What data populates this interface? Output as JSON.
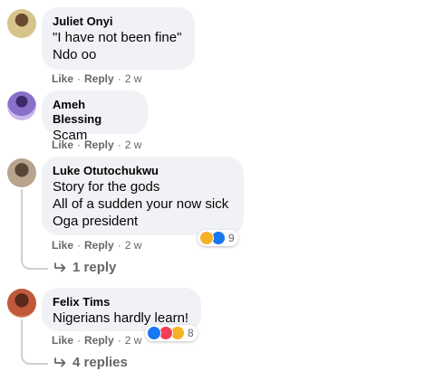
{
  "comments": [
    {
      "name": "Juliet Onyi",
      "lines": [
        "\"I have not been fine\"",
        "Ndo oo"
      ],
      "actions": {
        "like": "Like",
        "reply": "Reply",
        "time": "2 w"
      }
    },
    {
      "name": "Ameh Blessing",
      "lines": [
        "Scam"
      ],
      "actions": {
        "like": "Like",
        "reply": "Reply",
        "time": "2 w"
      }
    },
    {
      "name": "Luke Otutochukwu",
      "lines": [
        "Story for the gods",
        "All of a sudden your now sick",
        "Oga president"
      ],
      "actions": {
        "like": "Like",
        "reply": "Reply",
        "time": "2 w"
      },
      "reactions": {
        "icons": [
          "haha-icon",
          "like-icon"
        ],
        "count": "9"
      },
      "replies": "1 reply"
    },
    {
      "name": "Felix Tims",
      "lines": [
        "Nigerians hardly learn!"
      ],
      "actions": {
        "like": "Like",
        "reply": "Reply",
        "time": "2 w"
      },
      "reactions": {
        "icons": [
          "like-icon",
          "love-icon",
          "haha-icon"
        ],
        "count": "8"
      },
      "replies": "4 replies"
    }
  ],
  "separator": "·",
  "colors": {
    "bubble": "#f0f2f5",
    "meta_text": "#65676b",
    "like_blue": "#1877f2",
    "love_red": "#f33e58",
    "haha_yellow": "#f7b125"
  }
}
